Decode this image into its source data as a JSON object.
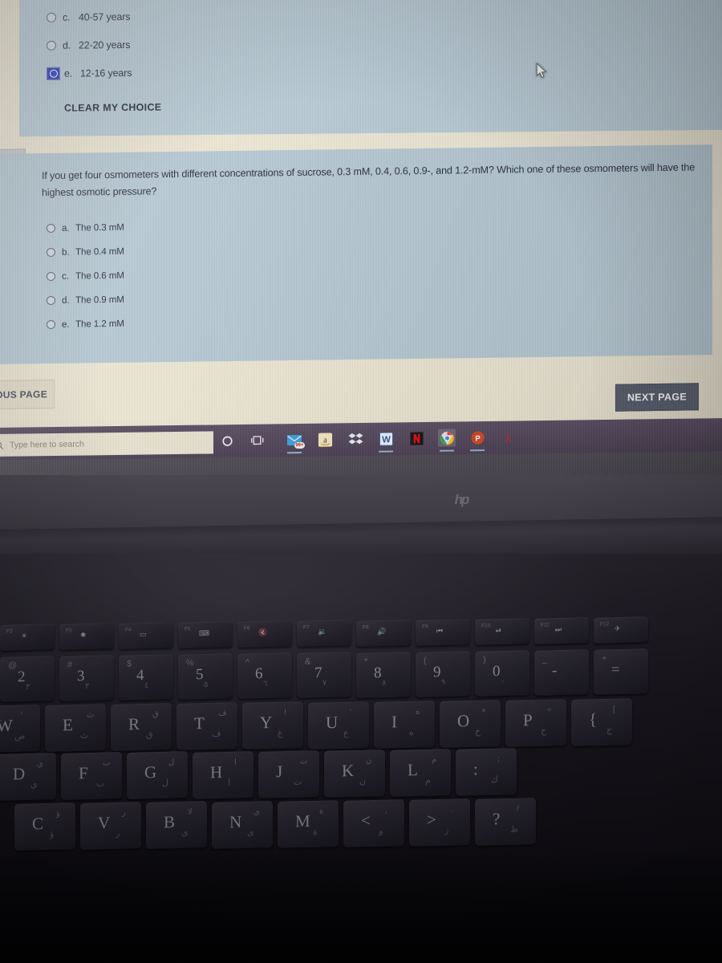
{
  "screen": {
    "quiz_top": {
      "options": [
        {
          "letter": "c.",
          "text": "40-57 years",
          "selected": false
        },
        {
          "letter": "d.",
          "text": "22-20 years",
          "selected": false
        },
        {
          "letter": "e.",
          "text": "12-16 years",
          "selected": true
        }
      ],
      "clear_choice_label": "CLEAR MY CHOICE"
    },
    "quiz_main": {
      "question": "If you get four osmometers with different concentrations of sucrose, 0.3 mM, 0.4, 0.6, 0.9-, and 1.2-mM? Which one of these osmometers will have the highest osmotic pressure?",
      "options": [
        {
          "letter": "a.",
          "text": "The 0.3 mM",
          "selected": false
        },
        {
          "letter": "b.",
          "text": "The 0.4 mM",
          "selected": false
        },
        {
          "letter": "c.",
          "text": "The 0.6 mM",
          "selected": false
        },
        {
          "letter": "d.",
          "text": "The 0.9 mM",
          "selected": false
        },
        {
          "letter": "e.",
          "text": "The 1.2 mM",
          "selected": false
        }
      ]
    },
    "side_panel_text": "t",
    "navigation": {
      "previous_label": "VIOUS PAGE",
      "next_label": "NEXT PAGE"
    },
    "colors": {
      "question_panel": "#b7c9d4",
      "page_background": "#ece6d3",
      "next_button": "#585e6e",
      "selected_radio": "#2742d6"
    }
  },
  "taskbar": {
    "search_placeholder": "Type here to search",
    "search_icon": "search-icon",
    "system_icons": [
      {
        "name": "cortana-icon",
        "glyph": "O"
      },
      {
        "name": "task-view-icon",
        "glyph": "task-view"
      }
    ],
    "apps": [
      {
        "name": "mail-icon",
        "badge": "99+",
        "color": "#2d8ccd",
        "running": true
      },
      {
        "name": "amazon-icon",
        "badge": "",
        "color": "#f0c14b",
        "running": false
      },
      {
        "name": "dropbox-icon",
        "badge": "",
        "color": "#e8eef5",
        "running": false
      },
      {
        "name": "word-icon",
        "badge": "",
        "color": "#2b579a",
        "running": true
      },
      {
        "name": "netflix-icon",
        "badge": "",
        "color": "#1a1a1a",
        "running": false
      },
      {
        "name": "chrome-icon",
        "badge": "",
        "color": "#4ca94c",
        "running": true,
        "active": true
      },
      {
        "name": "powerpoint-icon",
        "badge": "",
        "color": "#d24726",
        "running": true
      },
      {
        "name": "adobe-acrobat-icon",
        "badge": "",
        "color": "#cc2229",
        "running": false
      }
    ]
  },
  "laptop": {
    "brand_logo": "hp",
    "keyboard": {
      "function_row": [
        {
          "main": "",
          "sub": "F2",
          "icon": "brightness-down-icon"
        },
        {
          "main": "",
          "sub": "F3",
          "icon": "brightness-up-icon"
        },
        {
          "main": "",
          "sub": "F4",
          "icon": "display-switch-icon"
        },
        {
          "main": "",
          "sub": "F5",
          "icon": "keyboard-backlight-icon"
        },
        {
          "main": "",
          "sub": "F6",
          "icon": "mute-icon"
        },
        {
          "main": "",
          "sub": "F7",
          "icon": "volume-down-icon"
        },
        {
          "main": "",
          "sub": "F8",
          "icon": "volume-up-icon"
        },
        {
          "main": "",
          "sub": "F9",
          "icon": "previous-track-icon"
        },
        {
          "main": "",
          "sub": "F10",
          "icon": "play-pause-icon"
        },
        {
          "main": "",
          "sub": "F11",
          "icon": "next-track-icon"
        },
        {
          "main": "",
          "sub": "F12",
          "icon": "airplane-mode-icon"
        }
      ],
      "number_row": [
        {
          "main": "2",
          "sub": "@",
          "alt": "٣"
        },
        {
          "main": "3",
          "sub": "#",
          "alt": "٣"
        },
        {
          "main": "4",
          "sub": "$",
          "alt": "٤"
        },
        {
          "main": "5",
          "sub": "%",
          "alt": "٥"
        },
        {
          "main": "6",
          "sub": "^",
          "alt": "٦"
        },
        {
          "main": "7",
          "sub": "&",
          "alt": "٧"
        },
        {
          "main": "8",
          "sub": "*",
          "alt": "٨"
        },
        {
          "main": "9",
          "sub": "(",
          "alt": "٩"
        },
        {
          "main": "0",
          "sub": ")",
          "alt": "٠"
        },
        {
          "main": "-",
          "sub": "_",
          "alt": ""
        },
        {
          "main": "=",
          "sub": "+",
          "alt": ""
        }
      ],
      "row_qwerty": [
        {
          "main": "W",
          "sub": "'",
          "alt": "ص"
        },
        {
          "main": "E",
          "sub": "ث",
          "alt": "ث"
        },
        {
          "main": "R",
          "sub": "ق",
          "alt": "ق"
        },
        {
          "main": "T",
          "sub": "ف",
          "alt": "ف"
        },
        {
          "main": "Y",
          "sub": "!",
          "alt": "غ"
        },
        {
          "main": "U",
          "sub": "'",
          "alt": "ع"
        },
        {
          "main": "I",
          "sub": "ه",
          "alt": "ه"
        },
        {
          "main": "O",
          "sub": "×",
          "alt": "خ"
        },
        {
          "main": "P",
          "sub": "÷",
          "alt": "ح"
        },
        {
          "main": "{",
          "sub": "[",
          "alt": "ج"
        }
      ],
      "row_asdf": [
        {
          "main": "D",
          "sub": "ي",
          "alt": "ي"
        },
        {
          "main": "F",
          "sub": "ب",
          "alt": "ب"
        },
        {
          "main": "G",
          "sub": "ل",
          "alt": "ل"
        },
        {
          "main": "H",
          "sub": "ا",
          "alt": "ا"
        },
        {
          "main": "J",
          "sub": "ت",
          "alt": "ت"
        },
        {
          "main": "K",
          "sub": "ن",
          "alt": "ن"
        },
        {
          "main": "L",
          "sub": "م",
          "alt": "م"
        },
        {
          "main": ":",
          "sub": ";",
          "alt": "ك"
        }
      ],
      "row_zxcv": [
        {
          "main": "C",
          "sub": "ؤ",
          "alt": "ؤ"
        },
        {
          "main": "V",
          "sub": "ر",
          "alt": "ر"
        },
        {
          "main": "B",
          "sub": "لا",
          "alt": "ى"
        },
        {
          "main": "N",
          "sub": "ى",
          "alt": "ى"
        },
        {
          "main": "M",
          "sub": "ة",
          "alt": "ة"
        },
        {
          "main": "<",
          "sub": ",",
          "alt": "و"
        },
        {
          "main": ">",
          "sub": ".",
          "alt": "ز"
        },
        {
          "main": "?",
          "sub": "/",
          "alt": "ظ"
        }
      ]
    }
  }
}
